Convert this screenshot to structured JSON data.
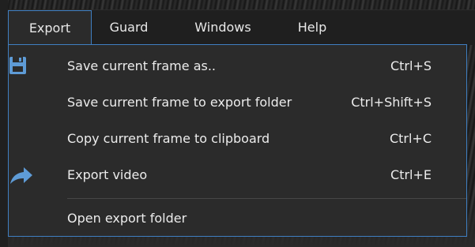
{
  "menubar": {
    "items": [
      {
        "label": "Export",
        "active": true
      },
      {
        "label": "Guard",
        "active": false
      },
      {
        "label": "Windows",
        "active": false
      },
      {
        "label": "Help",
        "active": false
      }
    ]
  },
  "dropdown": {
    "items": [
      {
        "label": "Save current frame as..",
        "shortcut": "Ctrl+S",
        "icon": "save-icon"
      },
      {
        "label": "Save current frame to export folder",
        "shortcut": "Ctrl+Shift+S",
        "icon": ""
      },
      {
        "label": "Copy current frame to clipboard",
        "shortcut": "Ctrl+C",
        "icon": ""
      },
      {
        "label": "Export video",
        "shortcut": "Ctrl+E",
        "icon": "share-arrow-icon"
      },
      {
        "label": "Open export folder",
        "shortcut": "",
        "icon": ""
      }
    ]
  },
  "colors": {
    "accent": "#3f7fc2",
    "icon": "#5e9bd6",
    "menu_bg": "#2b2b2b",
    "menubar_bg": "#1f1f1f",
    "text": "#ececec"
  }
}
